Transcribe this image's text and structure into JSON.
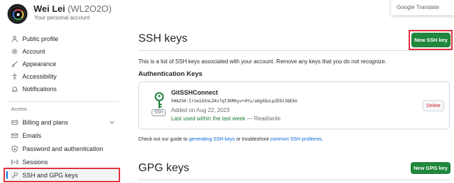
{
  "profile": {
    "name": "Wei Lei",
    "handle": "(WL2O2O)",
    "subtitle": "Your personal account"
  },
  "translate_popup": {
    "label": "Google Translate"
  },
  "sidebar": {
    "items": [
      {
        "label": "Public profile",
        "icon": "person-icon"
      },
      {
        "label": "Account",
        "icon": "gear-icon"
      },
      {
        "label": "Appearance",
        "icon": "paintbrush-icon"
      },
      {
        "label": "Accessibility",
        "icon": "accessibility-icon"
      },
      {
        "label": "Notifications",
        "icon": "bell-icon"
      }
    ],
    "section_label": "Access",
    "access_items": [
      {
        "label": "Billing and plans",
        "icon": "credit-card-icon",
        "expandable": true
      },
      {
        "label": "Emails",
        "icon": "mail-icon"
      },
      {
        "label": "Password and authentication",
        "icon": "shield-lock-icon"
      },
      {
        "label": "Sessions",
        "icon": "broadcast-icon"
      },
      {
        "label": "SSH and GPG keys",
        "icon": "key-icon",
        "active": true
      }
    ]
  },
  "ssh": {
    "title": "SSH keys",
    "new_button": "New SSH key",
    "intro": "This is a list of SSH keys associated with your account. Remove any keys that you do not recognize.",
    "auth_heading": "Authentication Keys",
    "key": {
      "name": "GitSSHConnect",
      "fingerprint": "SHA256:Irze1O3nLZ4v7qTJKMXyv+4Yu/aOgXQvLpZEDi3QEkU",
      "added": "Added on Aug 22, 2023",
      "last_used": "Last used within the last week",
      "access": " — Read/write",
      "tag": "SSH",
      "delete_label": "Delete"
    },
    "guide": {
      "prefix": "Check out our guide to ",
      "link1": "generating SSH keys",
      "middle": " or troubleshoot ",
      "link2": "common SSH problems",
      "suffix": "."
    }
  },
  "gpg": {
    "title": "GPG keys",
    "new_button": "New GPG key"
  },
  "colors": {
    "primary_button": "#1f883d",
    "link": "#0969da",
    "danger": "#cf222e",
    "annotation_box": "#e0313c",
    "active_indicator": "#0969da"
  }
}
